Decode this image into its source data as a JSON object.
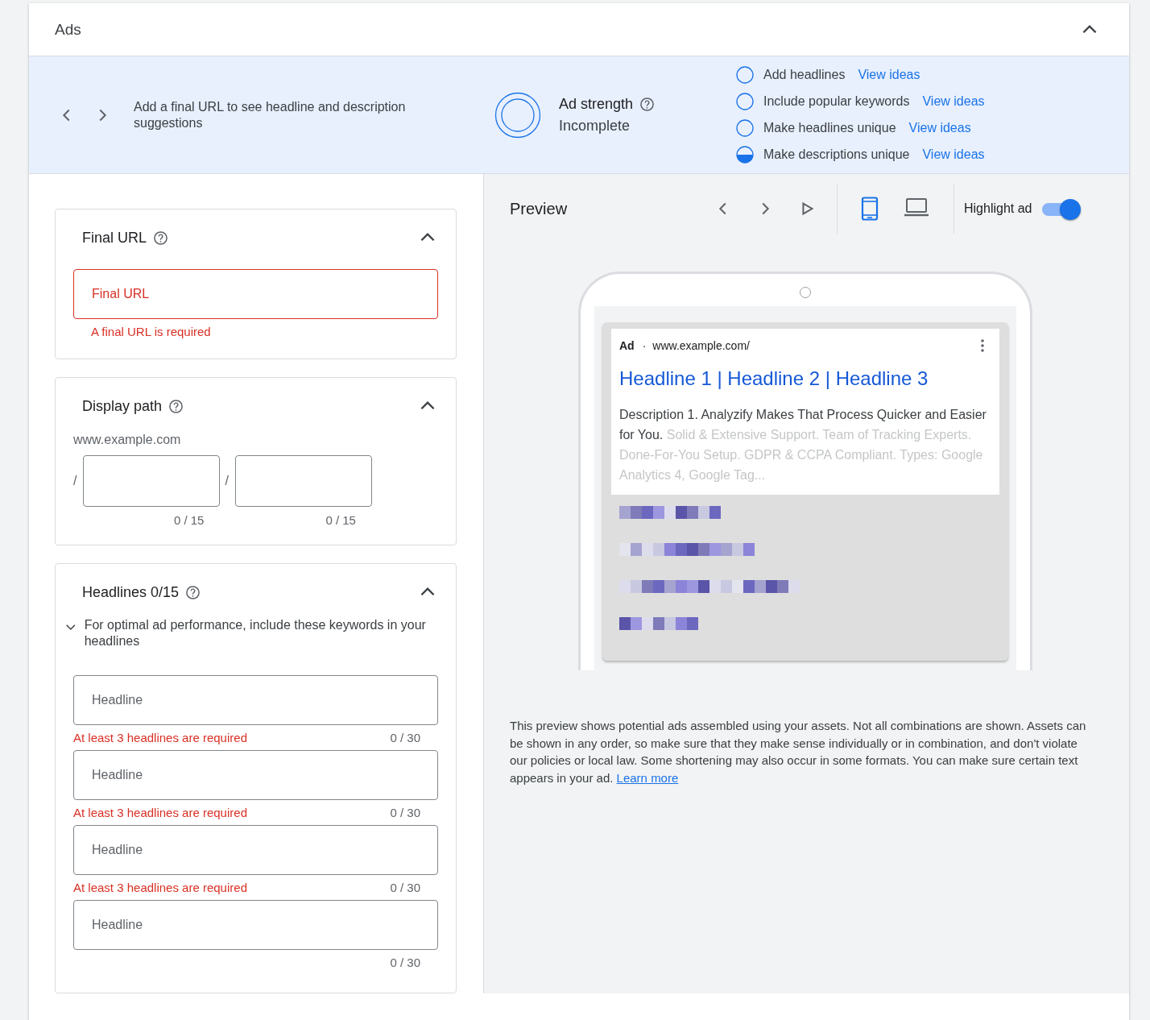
{
  "header": {
    "title": "Ads"
  },
  "suggestion_bar": {
    "message": "Add a final URL to see headline and description suggestions",
    "strength_label": "Ad strength",
    "strength_value": "Incomplete",
    "items": [
      {
        "kind": "empty",
        "label": "Add headlines",
        "link": "View ideas"
      },
      {
        "kind": "empty",
        "label": "Include popular keywords",
        "link": "View ideas"
      },
      {
        "kind": "empty",
        "label": "Make headlines unique",
        "link": "View ideas"
      },
      {
        "kind": "half",
        "label": "Make descriptions unique",
        "link": "View ideas"
      }
    ]
  },
  "final_url": {
    "title": "Final URL",
    "placeholder": "Final URL",
    "error": "A final URL is required"
  },
  "display_path": {
    "title": "Display path",
    "domain": "www.example.com",
    "separator": "/",
    "paths": [
      {
        "counter": "0 / 15"
      },
      {
        "counter": "0 / 15"
      }
    ]
  },
  "headlines": {
    "title": "Headlines 0/15",
    "hint": "For optimal ad performance, include these keywords in your headlines",
    "fields": [
      {
        "placeholder": "Headline",
        "error": "At least 3 headlines are required",
        "counter": "0 / 30"
      },
      {
        "placeholder": "Headline",
        "error": "At least 3 headlines are required",
        "counter": "0 / 30"
      },
      {
        "placeholder": "Headline",
        "error": "At least 3 headlines are required",
        "counter": "0 / 30"
      },
      {
        "placeholder": "Headline",
        "counter": "0 / 30"
      }
    ]
  },
  "preview": {
    "title": "Preview",
    "devices": [
      {
        "kind": "mobile",
        "selected": true
      },
      {
        "kind": "desktop",
        "selected": false
      }
    ],
    "highlight_label": "Highlight ad",
    "highlight_on": true,
    "ad": {
      "badge": "Ad",
      "separator": "·",
      "url": "www.example.com/",
      "headline": "Headline 1 | Headline 2 | Headline 3",
      "description_main": "Description 1. Analyzify Makes That Process Quicker and Easier for You.",
      "description_faded": "Solid & Extensive Support. Team of Tracking Experts. Done-For-You Setup. GDPR & CCPA Compliant. Types: Google Analytics 4, Google Tag..."
    },
    "note": "This preview shows potential ads assembled using your assets. Not all combinations are shown. Assets can be shown in any order, so make sure that they make sense individually or in combination, and don't violate our policies or local law. Some shortening may also occur in some formats. You can make sure certain text appears in your ad.",
    "note_link": "Learn more"
  }
}
